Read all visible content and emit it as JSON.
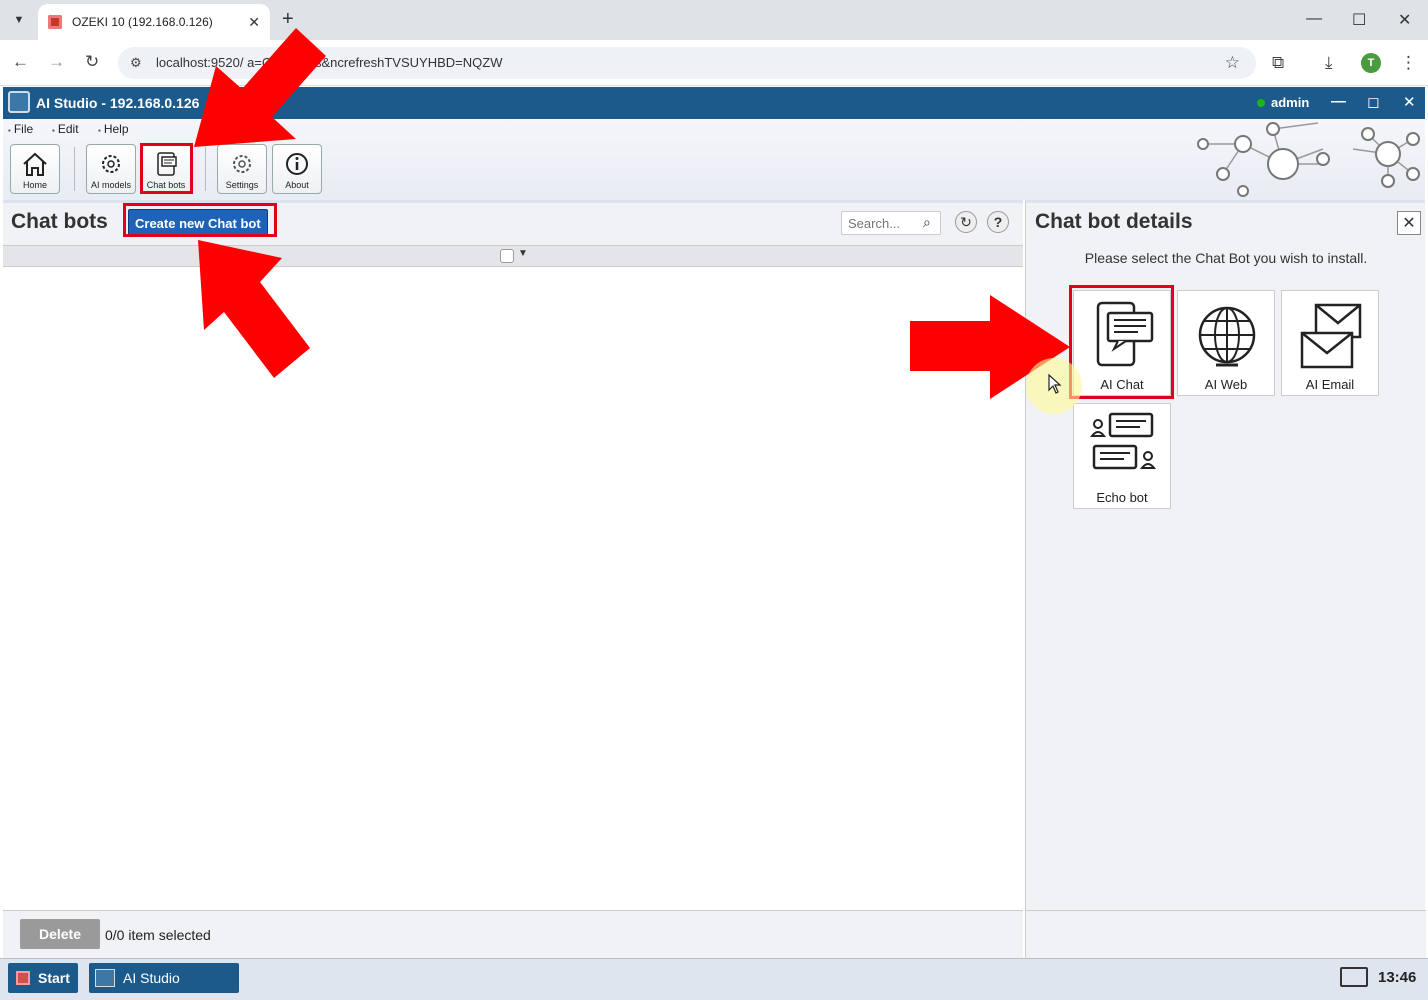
{
  "browser": {
    "tab_title": "OZEKI 10 (192.168.0.126)",
    "url": "localhost:9520/                a=Chat+bots&ncrefreshTVSUYHBD=NQZW",
    "profile_initial": "T"
  },
  "app": {
    "title": "AI Studio - 192.168.0.126",
    "user": "admin"
  },
  "menu": [
    "File",
    "Edit",
    "Help"
  ],
  "toolbar": {
    "home": "Home",
    "ai_models": "AI models",
    "chat_bots": "Chat bots",
    "settings": "Settings",
    "about": "About"
  },
  "left_panel": {
    "title": "Chat bots",
    "create_button": "Create new Chat bot",
    "search_placeholder": "Search...",
    "delete_button": "Delete",
    "selection_status": "0/0 item selected"
  },
  "right_panel": {
    "title": "Chat bot details",
    "instruction": "Please select the Chat Bot you wish to install.",
    "bots": [
      "AI Chat",
      "AI Web",
      "AI Email",
      "Echo bot"
    ]
  },
  "taskbar": {
    "start": "Start",
    "task": "AI Studio",
    "clock": "13:46"
  },
  "colors": {
    "app_bar": "#1d5a8c",
    "highlight": "#e0001a",
    "primary_button": "#1e63b8"
  }
}
